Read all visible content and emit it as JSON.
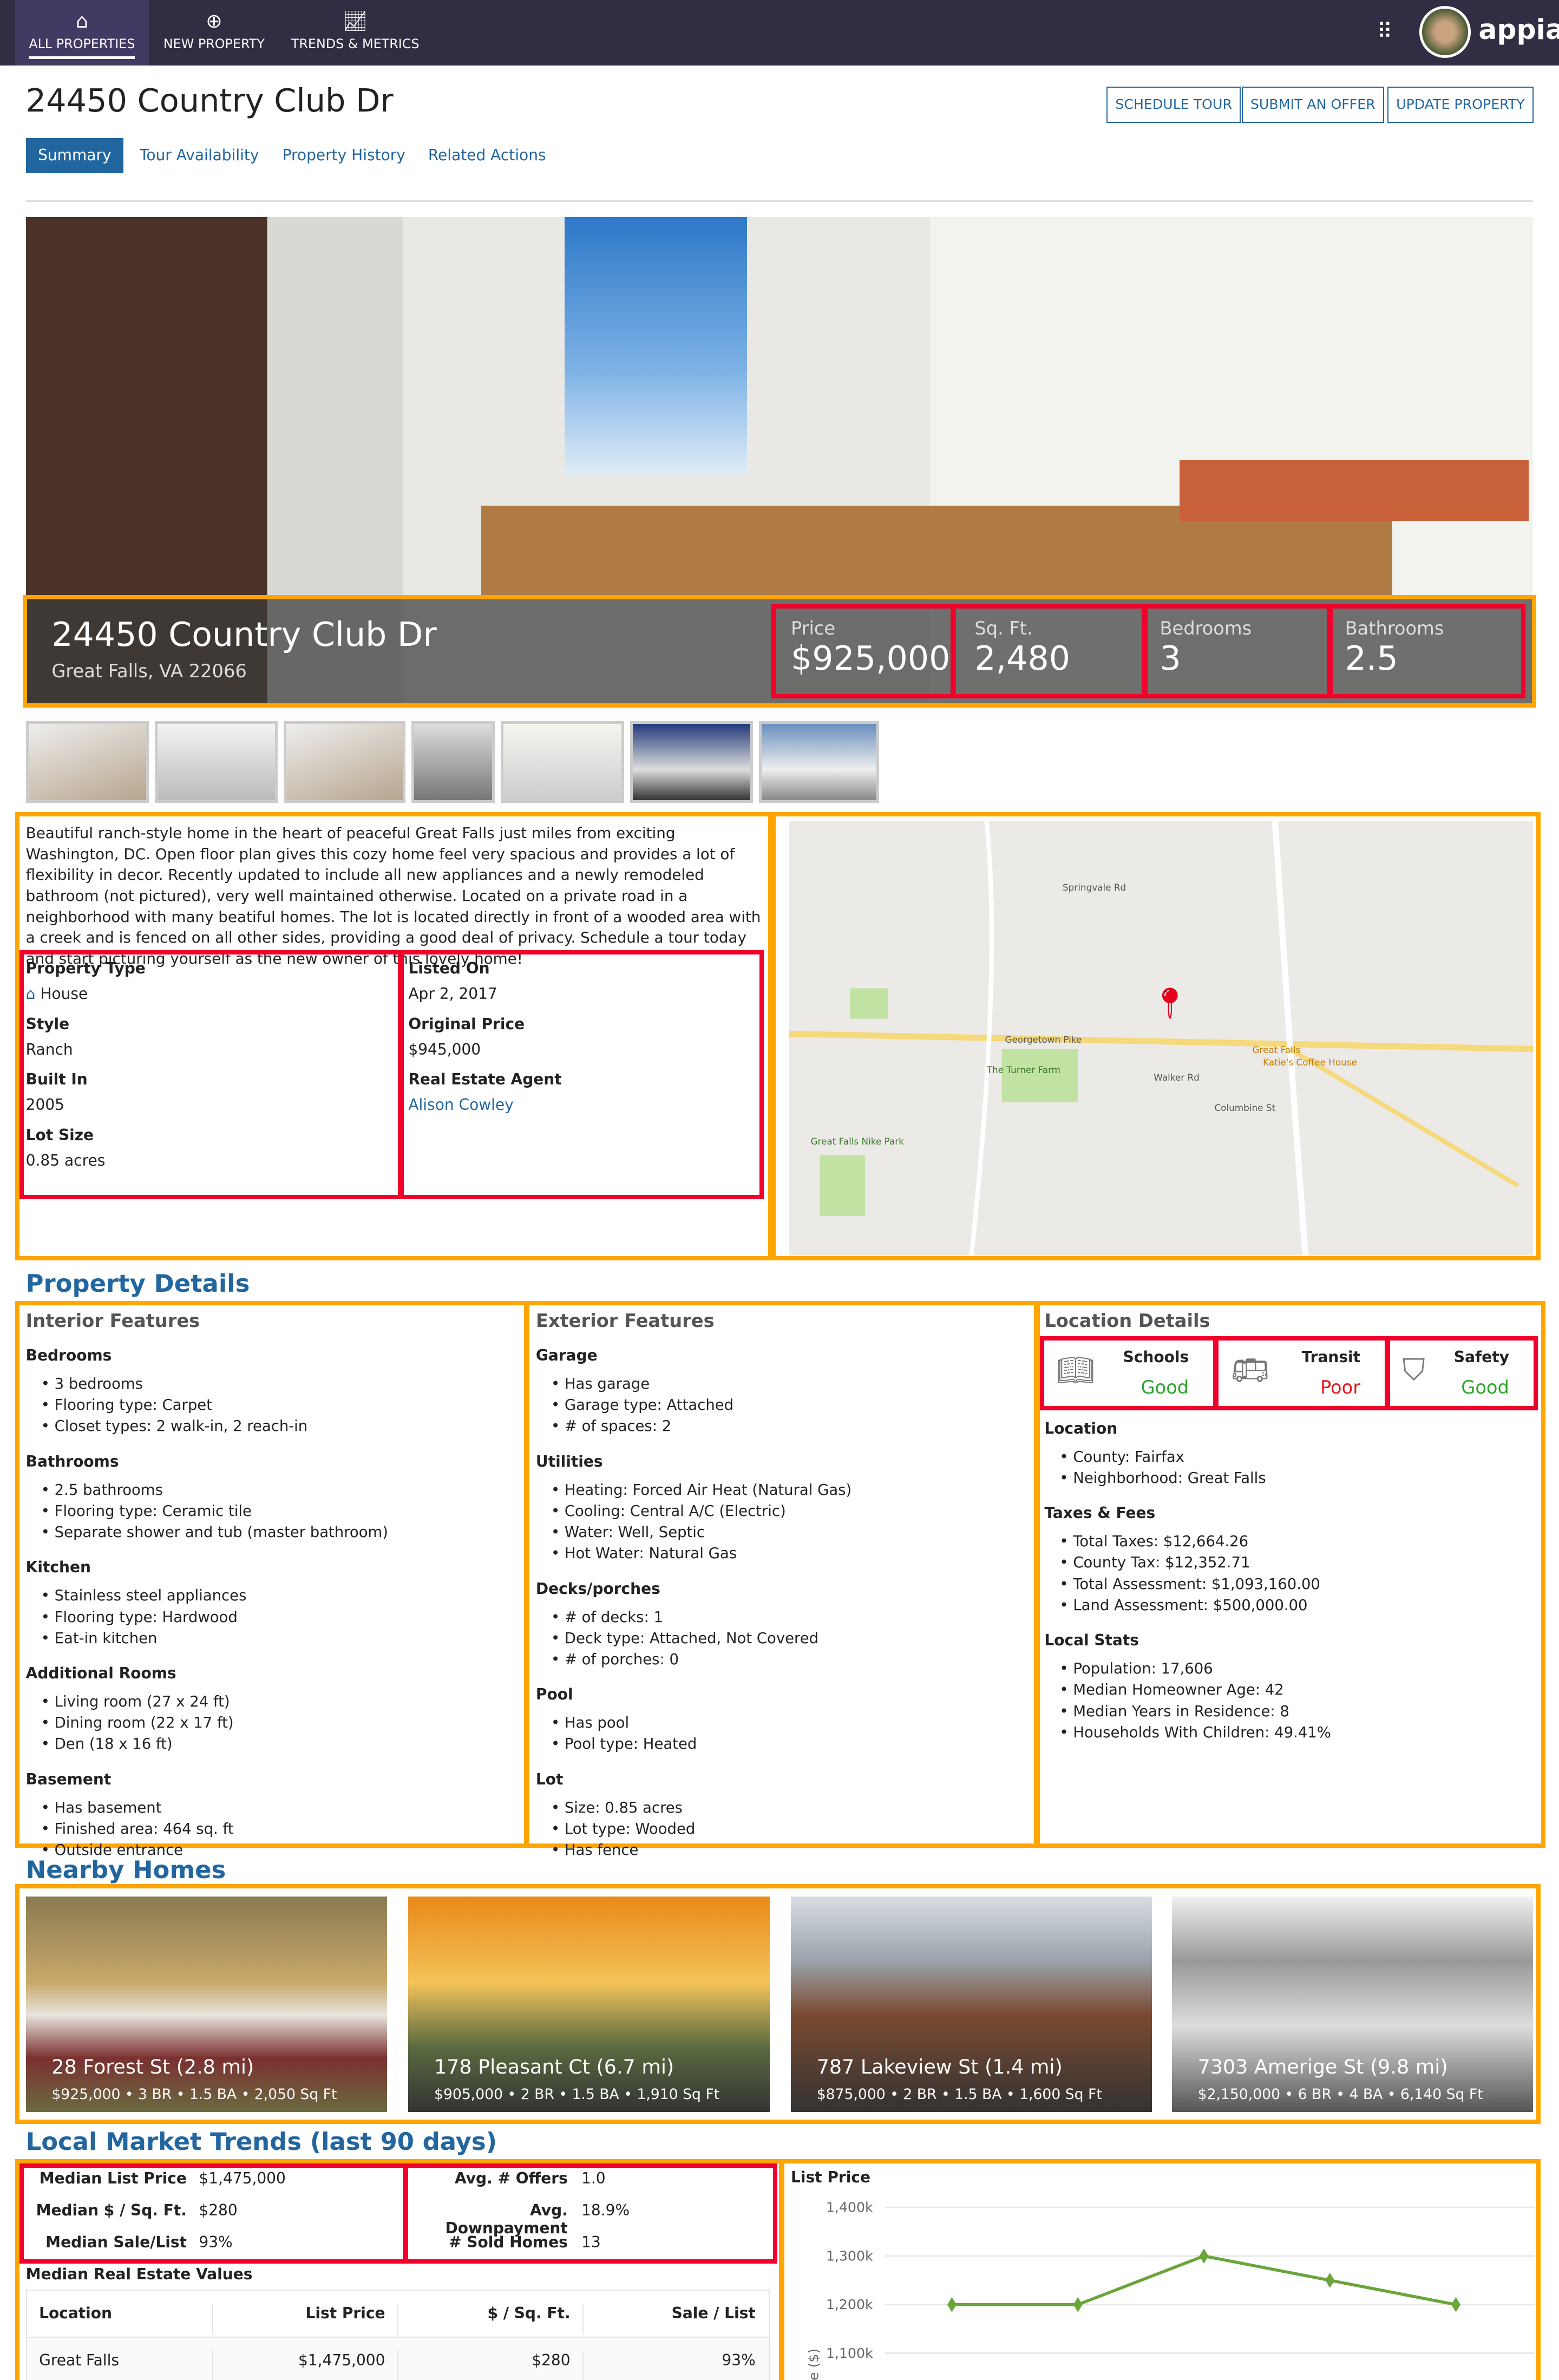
{
  "nav": {
    "items": [
      {
        "label": "ALL PROPERTIES",
        "icon": "home-icon"
      },
      {
        "label": "NEW PROPERTY",
        "icon": "plus-circle-icon"
      },
      {
        "label": "TRENDS & METRICS",
        "icon": "chart-line-icon"
      }
    ],
    "brand": "appian"
  },
  "header": {
    "title": "24450 Country Club Dr",
    "buttons": [
      "SCHEDULE TOUR",
      "SUBMIT AN OFFER",
      "UPDATE PROPERTY"
    ],
    "tabs": [
      "Summary",
      "Tour Availability",
      "Property History",
      "Related Actions"
    ]
  },
  "hero": {
    "address": "24450 Country Club Dr",
    "city": "Great Falls, VA 22066",
    "stats": [
      {
        "k": "Price",
        "v": "$925,000"
      },
      {
        "k": "Sq. Ft.",
        "v": "2,480"
      },
      {
        "k": "Bedrooms",
        "v": "3"
      },
      {
        "k": "Bathrooms",
        "v": "2.5"
      }
    ]
  },
  "description": "Beautiful ranch-style home in the heart of peaceful Great Falls just miles from exciting Washington, DC. Open floor plan gives this cozy home feel very spacious and provides a lot of flexibility in decor. Recently updated to include all new appliances and a newly remodeled bathroom (not pictured), very well maintained otherwise. Located on a private road in a neighborhood with many beatiful homes. The lot is located directly in front of a wooded area with a creek and is fenced on all other sides, providing a good deal of privacy. Schedule a tour today and start picturing yourself as the new owner of this lovely home!",
  "facts": {
    "left": [
      {
        "k": "Property Type",
        "v": "House"
      },
      {
        "k": "Style",
        "v": "Ranch"
      },
      {
        "k": "Built In",
        "v": "2005"
      },
      {
        "k": "Lot Size",
        "v": "0.85 acres"
      }
    ],
    "right": [
      {
        "k": "Listed On",
        "v": "Apr 2, 2017"
      },
      {
        "k": "Original Price",
        "v": "$945,000"
      },
      {
        "k": "Real Estate Agent",
        "v": "Alison Cowley"
      }
    ]
  },
  "map": {
    "labels": [
      "Georgetown Pike",
      "Great Falls",
      "Katie's Coffee House",
      "The Turner Farm",
      "Great Falls Nike Park",
      "Walker Rd",
      "Columbine St",
      "Springvale Rd"
    ]
  },
  "details": {
    "title": "Property Details",
    "interior": {
      "title": "Interior Features",
      "groups": [
        {
          "h": "Bedrooms",
          "items": [
            "3 bedrooms",
            "Flooring type: Carpet",
            "Closet types: 2 walk-in, 2 reach-in"
          ]
        },
        {
          "h": "Bathrooms",
          "items": [
            "2.5 bathrooms",
            "Flooring type: Ceramic tile",
            "Separate shower and tub (master bathroom)"
          ]
        },
        {
          "h": "Kitchen",
          "items": [
            "Stainless steel appliances",
            "Flooring type: Hardwood",
            "Eat-in kitchen"
          ]
        },
        {
          "h": "Additional Rooms",
          "items": [
            "Living room (27 x 24 ft)",
            "Dining room (22 x 17 ft)",
            "Den (18 x 16 ft)"
          ]
        },
        {
          "h": "Basement",
          "items": [
            "Has basement",
            "Finished area: 464 sq. ft",
            "Outside entrance"
          ]
        }
      ]
    },
    "exterior": {
      "title": "Exterior Features",
      "groups": [
        {
          "h": "Garage",
          "items": [
            "Has garage",
            "Garage type: Attached",
            "# of spaces: 2"
          ]
        },
        {
          "h": "Utilities",
          "items": [
            "Heating: Forced Air Heat (Natural Gas)",
            "Cooling: Central A/C (Electric)",
            "Water: Well, Septic",
            "Hot Water: Natural Gas"
          ]
        },
        {
          "h": "Decks/porches",
          "items": [
            "# of decks: 1",
            "Deck type: Attached, Not Covered",
            "# of porches: 0"
          ]
        },
        {
          "h": "Pool",
          "items": [
            "Has pool",
            "Pool type: Heated"
          ]
        },
        {
          "h": "Lot",
          "items": [
            "Size: 0.85 acres",
            "Lot type: Wooded",
            "Has fence"
          ]
        }
      ]
    },
    "location": {
      "title": "Location Details",
      "scores": [
        {
          "k": "Schools",
          "v": "Good",
          "color": "#2aa52a",
          "icon": "book-icon"
        },
        {
          "k": "Transit",
          "v": "Poor",
          "color": "#e8161b",
          "icon": "bus-icon"
        },
        {
          "k": "Safety",
          "v": "Good",
          "color": "#2aa52a",
          "icon": "shield-star-icon"
        }
      ],
      "groups": [
        {
          "h": "Location",
          "items": [
            "County: Fairfax",
            "Neighborhood: Great Falls"
          ]
        },
        {
          "h": "Taxes & Fees",
          "items": [
            "Total Taxes: $12,664.26",
            "County Tax: $12,352.71",
            "Total Assessment: $1,093,160.00",
            "Land Assessment: $500,000.00"
          ]
        },
        {
          "h": "Local Stats",
          "items": [
            "Population: 17,606",
            "Median Homeowner Age: 42",
            "Median Years in Residence: 8",
            "Households With Children: 49.41%"
          ]
        }
      ]
    }
  },
  "nearby": {
    "title": "Nearby Homes",
    "homes": [
      {
        "t": "28 Forest St (2.8 mi)",
        "s": "$925,000 • 3 BR • 1.5 BA • 2,050 Sq Ft"
      },
      {
        "t": "178 Pleasant Ct (6.7 mi)",
        "s": "$905,000 • 2 BR • 1.5 BA • 1,910 Sq Ft"
      },
      {
        "t": "787 Lakeview St (1.4 mi)",
        "s": "$875,000 • 2 BR • 1.5 BA • 1,600 Sq Ft"
      },
      {
        "t": "7303 Amerige St (9.8 mi)",
        "s": "$2,150,000 • 6 BR • 4 BA • 6,140 Sq Ft"
      }
    ]
  },
  "market": {
    "title": "Local Market Trends (last 90 days)",
    "left": [
      {
        "k": "Median List Price",
        "v": "$1,475,000"
      },
      {
        "k": "Median $ / Sq. Ft.",
        "v": "$280"
      },
      {
        "k": "Median Sale/List",
        "v": "93%"
      }
    ],
    "right": [
      {
        "k": "Avg. # Offers",
        "v": "1.0"
      },
      {
        "k": "Avg. Downpayment",
        "v": "18.9%"
      },
      {
        "k": "# Sold Homes",
        "v": "13"
      }
    ],
    "table": {
      "title": "Median Real Estate Values",
      "headers": [
        "Location",
        "List Price",
        "$ / Sq. Ft.",
        "Sale / List"
      ],
      "rows": [
        [
          "Great Falls",
          "$1,475,000",
          "$280",
          "93%"
        ]
      ]
    }
  },
  "chart_data": {
    "type": "line",
    "title": "List Price",
    "ylabel": "e ($)",
    "yticks": [
      "1,400k",
      "1,300k",
      "1,200k",
      "1,100k"
    ],
    "ylim": [
      1100,
      1400
    ],
    "grid": true,
    "series": [
      {
        "values": [
          1200,
          1200,
          1300,
          1250,
          1200
        ],
        "color": "#6aa53a"
      }
    ]
  }
}
